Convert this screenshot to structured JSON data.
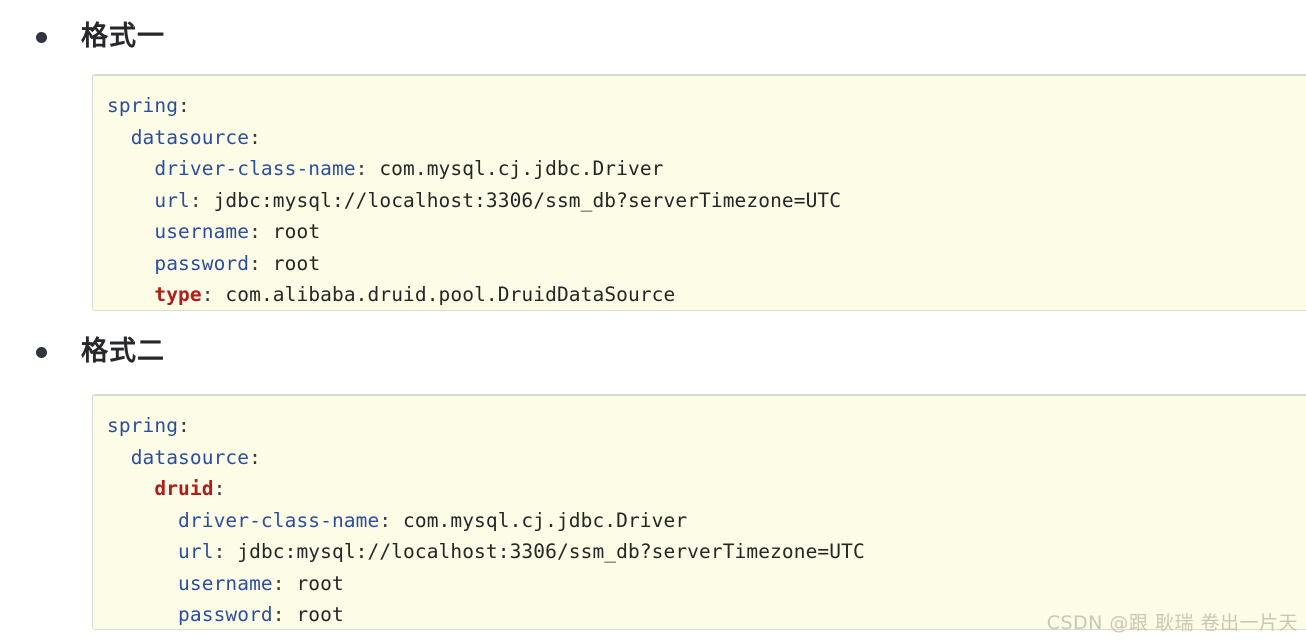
{
  "sections": [
    {
      "bullet": "filled-dot",
      "heading": "格式一",
      "code": {
        "lines": [
          {
            "indent": 0,
            "key": "spring",
            "key_style": "key",
            "value": ""
          },
          {
            "indent": 1,
            "key": "datasource",
            "key_style": "key",
            "value": ""
          },
          {
            "indent": 2,
            "key": "driver-class-name",
            "key_style": "key",
            "value": "com.mysql.cj.jdbc.Driver"
          },
          {
            "indent": 2,
            "key": "url",
            "key_style": "key",
            "value": "jdbc:mysql://localhost:3306/ssm_db?serverTimezone=UTC"
          },
          {
            "indent": 2,
            "key": "username",
            "key_style": "key",
            "value": "root"
          },
          {
            "indent": 2,
            "key": "password",
            "key_style": "key",
            "value": "root"
          },
          {
            "indent": 2,
            "key": "type",
            "key_style": "kw",
            "value": "com.alibaba.druid.pool.DruidDataSource"
          }
        ]
      }
    },
    {
      "bullet": "filled-dot",
      "heading": "格式二",
      "code": {
        "lines": [
          {
            "indent": 0,
            "key": "spring",
            "key_style": "key",
            "value": ""
          },
          {
            "indent": 1,
            "key": "datasource",
            "key_style": "key",
            "value": ""
          },
          {
            "indent": 2,
            "key": "druid",
            "key_style": "kw",
            "value": ""
          },
          {
            "indent": 3,
            "key": "driver-class-name",
            "key_style": "key",
            "value": "com.mysql.cj.jdbc.Driver"
          },
          {
            "indent": 3,
            "key": "url",
            "key_style": "key",
            "value": "jdbc:mysql://localhost:3306/ssm_db?serverTimezone=UTC"
          },
          {
            "indent": 3,
            "key": "username",
            "key_style": "key",
            "value": "root"
          },
          {
            "indent": 3,
            "key": "password",
            "key_style": "key",
            "value": "root"
          }
        ]
      }
    }
  ],
  "watermark": {
    "text": "CSDN @跟 耿瑞 卷出一片天"
  },
  "colors": {
    "code_background": "#fdfce6",
    "code_border": "#dcdcd4",
    "key_blue": "#2b4f9e",
    "keyword_red": "#b01d1d",
    "text_dark": "#262626",
    "heading": "#26282b",
    "watermark": "#c9c8b4",
    "page_background": "#ffffff"
  }
}
